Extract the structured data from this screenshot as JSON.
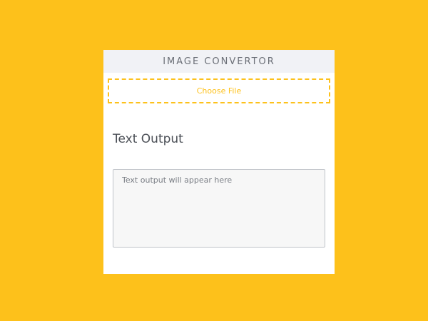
{
  "header": {
    "title": "IMAGE CONVERTOR"
  },
  "file_input": {
    "label": "Choose File"
  },
  "output": {
    "title": "Text Output",
    "value": "",
    "placeholder": "Text output will appear here"
  },
  "colors": {
    "background": "#FDC11B",
    "accent": "#FDC11B",
    "card": "#FFFFFF",
    "header_bg": "#F1F2F6",
    "text_dark": "#4B4F56"
  }
}
